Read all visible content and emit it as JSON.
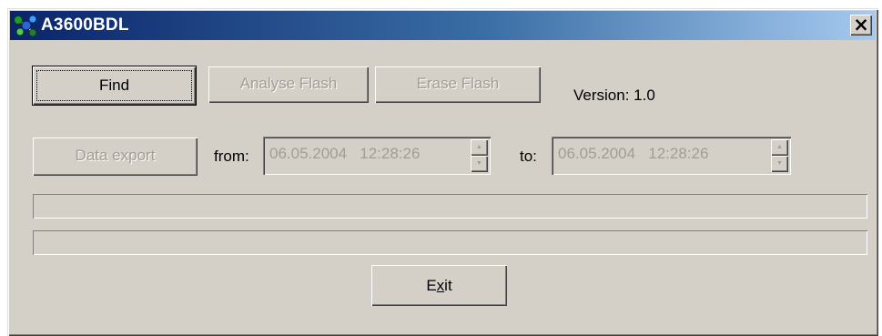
{
  "window": {
    "title": "A3600BDL",
    "close_label": "×"
  },
  "toolbar": {
    "find_label": "Find",
    "analyse_label": "Analyse Flash",
    "erase_label": "Erase Flash",
    "version_text": "Version:  1.0"
  },
  "export": {
    "button_label": "Data export",
    "from_label": "from:",
    "from_value": "06.05.2004   12:28:26",
    "to_label": "to:",
    "to_value": "06.05.2004   12:28:26"
  },
  "progress": {
    "bar1_fraction": 0,
    "bar2_fraction": 0
  },
  "footer": {
    "exit_label": "Exit",
    "exit_mnemonic": "x"
  },
  "colors": {
    "title_start": "#0a246a",
    "title_end": "#a6caf0",
    "face": "#d4d0c8"
  },
  "icons": {
    "app": "app-molecule-icon",
    "close": "close-icon",
    "spin_up": "spin-up-icon",
    "spin_down": "spin-down-icon"
  }
}
